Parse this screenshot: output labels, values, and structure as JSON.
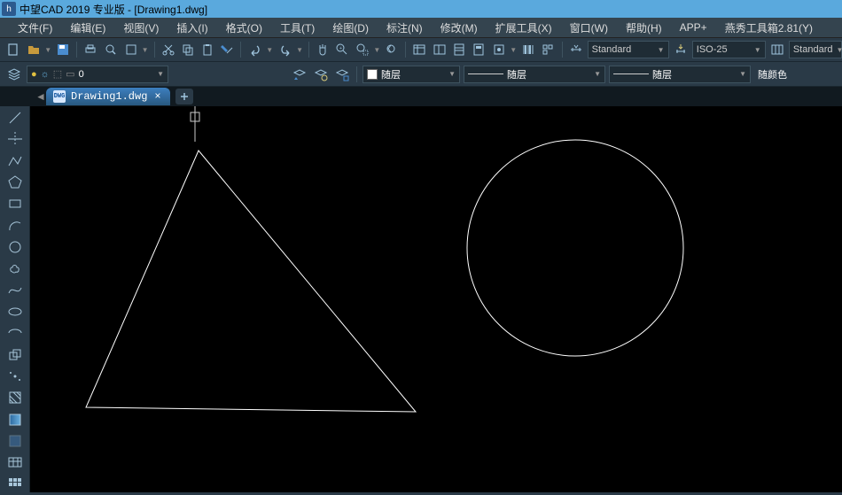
{
  "title": "中望CAD 2019 专业版 - [Drawing1.dwg]",
  "logo_char": "h",
  "menubar": [
    "文件(F)",
    "编辑(E)",
    "视图(V)",
    "插入(I)",
    "格式(O)",
    "工具(T)",
    "绘图(D)",
    "标注(N)",
    "修改(M)",
    "扩展工具(X)",
    "窗口(W)",
    "帮助(H)",
    "APP+",
    "燕秀工具箱2.81(Y)"
  ],
  "toolbar1": {
    "style_combo": "Standard",
    "iso_combo": "ISO-25",
    "std_combo": "Standard"
  },
  "toolbar2": {
    "layer_value": "0",
    "color_label": "随层",
    "line_label": "随层",
    "weight_label": "随层",
    "plotstyle": "随颜色"
  },
  "tab": {
    "doc_label": "DWG",
    "name": "Drawing1.dwg",
    "close": "×",
    "new": "+"
  }
}
